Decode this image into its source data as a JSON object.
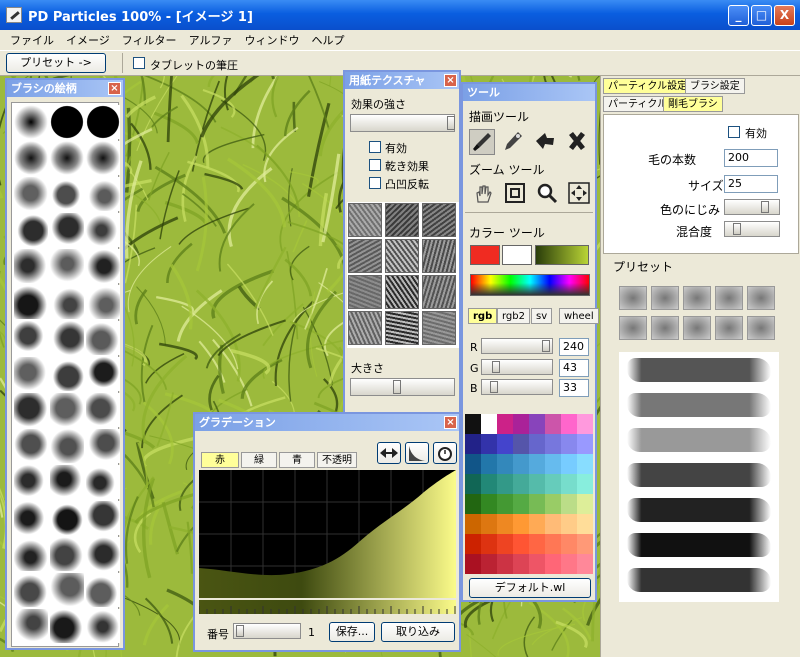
{
  "window": {
    "title": "PD Particles   100%   - [イメージ 1]",
    "min": "_",
    "max": "□",
    "close": "X"
  },
  "menu": [
    "ファイル",
    "イメージ",
    "フィルター",
    "アルファ",
    "ウィンドウ",
    "ヘルプ"
  ],
  "toolbar": {
    "preset_button": "プリセット ->",
    "tablet_label": "タブレットの筆圧"
  },
  "brush_palette": {
    "title": "ブラシの絵柄"
  },
  "paper_palette": {
    "title": "用紙テクスチャ",
    "strength_label": "効果の強さ",
    "checks": [
      "有効",
      "乾き効果",
      "凸凹反転"
    ],
    "size_label": "大きさ"
  },
  "tool_palette": {
    "title": "ツール",
    "draw_tools_label": "描画ツール",
    "zoom_tools_label": "ズーム ツール",
    "color_tools_label": "カラー ツール",
    "tabs": [
      "rgb",
      "rgb2",
      "sv",
      "wheel"
    ],
    "r_label": "R",
    "g_label": "G",
    "b_label": "B",
    "r_value": "240",
    "g_value": "43",
    "b_value": "33",
    "default_button": "デフォルト.wl"
  },
  "gradation_palette": {
    "title": "グラデーション",
    "tabs": [
      "赤",
      "緑",
      "青",
      "不透明"
    ],
    "number_label": "番号",
    "number_value": "1",
    "save_button": "保存...",
    "import_button": "取り込み"
  },
  "right_panel": {
    "top_tabs": [
      "パーティクル設定",
      "ブラシ設定"
    ],
    "sub_tabs": [
      "パーティクルス",
      "剛毛ブラシ"
    ],
    "enable_label": "有効",
    "hair_count_label": "毛の本数",
    "hair_count_value": "200",
    "size_label": "サイズ",
    "size_value": "25",
    "color_bleed_label": "色のにじみ",
    "mix_label": "混合度",
    "preset_label": "プリセット"
  },
  "colors": {
    "accent": "#7a96df",
    "swatch_red": "#f02b21",
    "swatch_white": "#ffffff"
  }
}
